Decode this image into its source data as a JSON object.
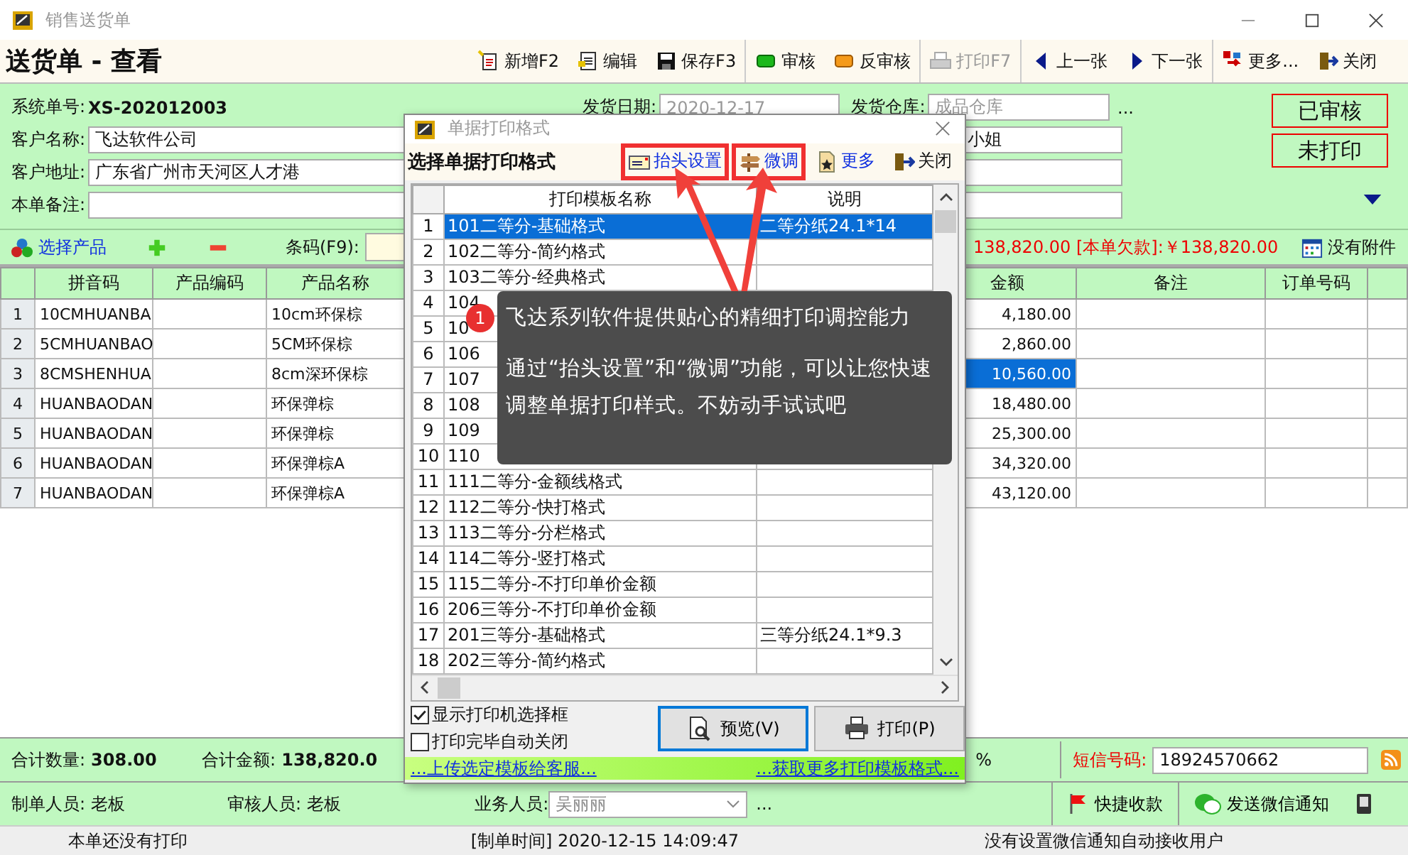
{
  "window": {
    "title": "销售送货单"
  },
  "header": {
    "title": "送货单 - 查看"
  },
  "toolbar": [
    {
      "label": "新增F2",
      "kind": "new",
      "disabled": false
    },
    {
      "label": "编辑",
      "kind": "edit",
      "disabled": false
    },
    {
      "label": "保存F3",
      "kind": "save",
      "disabled": false
    },
    {
      "label": "审核",
      "kind": "approve",
      "disabled": false
    },
    {
      "label": "反审核",
      "kind": "unapprove",
      "disabled": false
    },
    {
      "label": "打印F7",
      "kind": "print",
      "disabled": true
    },
    {
      "label": "上一张",
      "kind": "prev",
      "disabled": false
    },
    {
      "label": "下一张",
      "kind": "next",
      "disabled": false
    },
    {
      "label": "更多...",
      "kind": "more",
      "disabled": false
    },
    {
      "label": "关闭",
      "kind": "close",
      "disabled": false
    }
  ],
  "form": {
    "order_no_label": "系统单号:",
    "order_no": "XS-202012003",
    "date_label": "发货日期:",
    "date": "2020-12-17",
    "warehouse_label": "发货仓库:",
    "warehouse": "成品仓库",
    "warehouse_more": "...",
    "customer_label": "客户名称:",
    "customer": "飞达软件公司",
    "contact": "小姐",
    "address_label": "客户地址:",
    "address": "广东省广州市天河区人才港",
    "remark_label": "本单备注:"
  },
  "status_badges": [
    "已审核",
    "未打印"
  ],
  "product_bar": {
    "select_label": "选择产品",
    "barcode_label": "条码(F9):",
    "summary": "138,820.00 [本单欠款]:￥138,820.00",
    "attachment": "没有附件"
  },
  "table": {
    "columns": [
      "拼音码",
      "产品编码",
      "产品名称",
      "金额",
      "备注",
      "订单号码"
    ],
    "rows": [
      {
        "num": "1",
        "pinyin": "10CMHUANBA",
        "name": "10cm环保棕",
        "amount": "4,180.00",
        "selected": false
      },
      {
        "num": "2",
        "pinyin": "5CMHUANBAO",
        "name": "5CM环保棕",
        "amount": "2,860.00",
        "selected": false
      },
      {
        "num": "3",
        "pinyin": "8CMSHENHUA",
        "name": "8cm深环保棕",
        "amount": "10,560.00",
        "selected": true
      },
      {
        "num": "4",
        "pinyin": "HUANBAODAN",
        "name": "环保弹棕",
        "amount": "18,480.00",
        "selected": false
      },
      {
        "num": "5",
        "pinyin": "HUANBAODAN",
        "name": "环保弹棕",
        "amount": "25,300.00",
        "selected": false
      },
      {
        "num": "6",
        "pinyin": "HUANBAODAN",
        "name": "环保弹棕A",
        "amount": "34,320.00",
        "selected": false
      },
      {
        "num": "7",
        "pinyin": "HUANBAODAN",
        "name": "环保弹棕A",
        "amount": "43,120.00",
        "selected": false
      }
    ]
  },
  "totals": {
    "qty_label": "合计数量:",
    "qty": "308.00",
    "amount_label": "合计金额:",
    "amount": "138,820.0",
    "percent": "%",
    "sms_label": "短信号码:",
    "sms": "18924570662"
  },
  "people": {
    "maker_label": "制单人员:",
    "maker": "老板",
    "auditor_label": "审核人员:",
    "auditor": "老板",
    "sales_label": "业务人员:",
    "sales": "吴丽丽",
    "sales_more": "...",
    "collect": "快捷收款",
    "wechat": "发送微信通知"
  },
  "status_bar": [
    "本单还没有打印",
    "[制单时间] 2020-12-15 14:09:47",
    "没有设置微信通知自动接收用户"
  ],
  "dialog": {
    "title": "单据打印格式",
    "heading": "选择单据打印格式",
    "actions": [
      {
        "label": "抬头设置",
        "kind": "header",
        "highlighted": true
      },
      {
        "label": "微调",
        "kind": "adjust",
        "highlighted": true
      },
      {
        "label": "更多",
        "kind": "more",
        "highlighted": false
      },
      {
        "label": "关闭",
        "kind": "close",
        "highlighted": false
      }
    ],
    "columns": [
      "打印模板名称",
      "说明"
    ],
    "rows": [
      {
        "num": "1",
        "name": "101二等分-基础格式",
        "note": "二等分纸24.1*14",
        "selected": true
      },
      {
        "num": "2",
        "name": "102二等分-简约格式",
        "selected": false
      },
      {
        "num": "3",
        "name": "103二等分-经典格式",
        "selected": false
      },
      {
        "num": "4",
        "name": "104",
        "selected": false
      },
      {
        "num": "5",
        "name": "10",
        "selected": false
      },
      {
        "num": "6",
        "name": "106",
        "selected": false
      },
      {
        "num": "7",
        "name": "107",
        "selected": false
      },
      {
        "num": "8",
        "name": "108",
        "selected": false
      },
      {
        "num": "9",
        "name": "109",
        "selected": false
      },
      {
        "num": "10",
        "name": "110",
        "selected": false
      },
      {
        "num": "11",
        "name": "111二等分-金额线格式",
        "selected": false
      },
      {
        "num": "12",
        "name": "112二等分-快打格式",
        "selected": false
      },
      {
        "num": "13",
        "name": "113二等分-分栏格式",
        "selected": false
      },
      {
        "num": "14",
        "name": "114二等分-竖打格式",
        "selected": false
      },
      {
        "num": "15",
        "name": "115二等分-不打印单价金额",
        "selected": false
      },
      {
        "num": "16",
        "name": "206三等分-不打印单价金额",
        "selected": false
      },
      {
        "num": "17",
        "name": "201三等分-基础格式",
        "note": "三等分纸24.1*9.3",
        "selected": false
      },
      {
        "num": "18",
        "name": "202三等分-简约格式",
        "selected": false
      }
    ],
    "options": [
      {
        "label": "显示打印机选择框",
        "checked": true
      },
      {
        "label": "打印完毕自动关闭",
        "checked": false
      }
    ],
    "buttons": [
      {
        "label": "预览(V)",
        "kind": "preview",
        "focused": true
      },
      {
        "label": "打印(P)",
        "kind": "print",
        "focused": false
      }
    ],
    "links": [
      "...上传选定模板给客服...",
      "...获取更多打印模板格式..."
    ]
  },
  "tip": {
    "badge": "1",
    "lines": [
      "飞达系列软件提供贴心的精细打印调控能力",
      "通过“抬头设置”和“微调”功能，可以让您快速调整单据打印样式。不妨动手试试吧"
    ]
  }
}
